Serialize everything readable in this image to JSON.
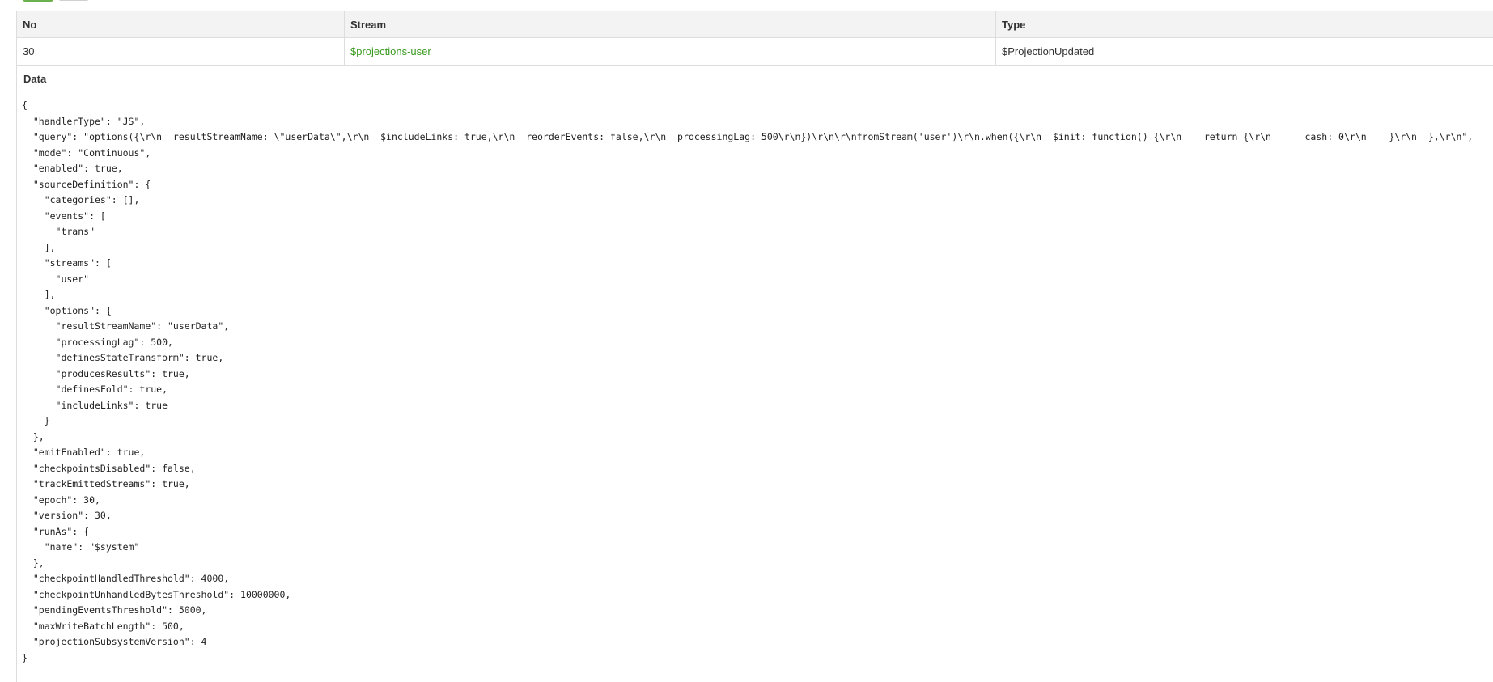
{
  "table": {
    "headers": {
      "no": "No",
      "stream": "Stream",
      "type": "Type"
    },
    "rows": [
      {
        "no": "30",
        "stream": "$projections-user",
        "type": "$ProjectionUpdated"
      }
    ]
  },
  "data_section": {
    "label": "Data",
    "json_text": "{\n  \"handlerType\": \"JS\",\n  \"query\": \"options({\\r\\n  resultStreamName: \\\"userData\\\",\\r\\n  $includeLinks: true,\\r\\n  reorderEvents: false,\\r\\n  processingLag: 500\\r\\n})\\r\\n\\r\\nfromStream('user')\\r\\n.when({\\r\\n  $init: function() {\\r\\n    return {\\r\\n      cash: 0\\r\\n    }\\r\\n  },\\r\\n\",\n  \"mode\": \"Continuous\",\n  \"enabled\": true,\n  \"sourceDefinition\": {\n    \"categories\": [],\n    \"events\": [\n      \"trans\"\n    ],\n    \"streams\": [\n      \"user\"\n    ],\n    \"options\": {\n      \"resultStreamName\": \"userData\",\n      \"processingLag\": 500,\n      \"definesStateTransform\": true,\n      \"producesResults\": true,\n      \"definesFold\": true,\n      \"includeLinks\": true\n    }\n  },\n  \"emitEnabled\": true,\n  \"checkpointsDisabled\": false,\n  \"trackEmittedStreams\": true,\n  \"epoch\": 30,\n  \"version\": 30,\n  \"runAs\": {\n    \"name\": \"$system\"\n  },\n  \"checkpointHandledThreshold\": 4000,\n  \"checkpointUnhandledBytesThreshold\": 10000000,\n  \"pendingEventsThreshold\": 5000,\n  \"maxWriteBatchLength\": 500,\n  \"projectionSubsystemVersion\": 4\n}"
  },
  "colors": {
    "link": "#3a9a1f",
    "header_bg": "#f3f3f3",
    "border": "#dddddd",
    "accent": "#6ab04c"
  }
}
